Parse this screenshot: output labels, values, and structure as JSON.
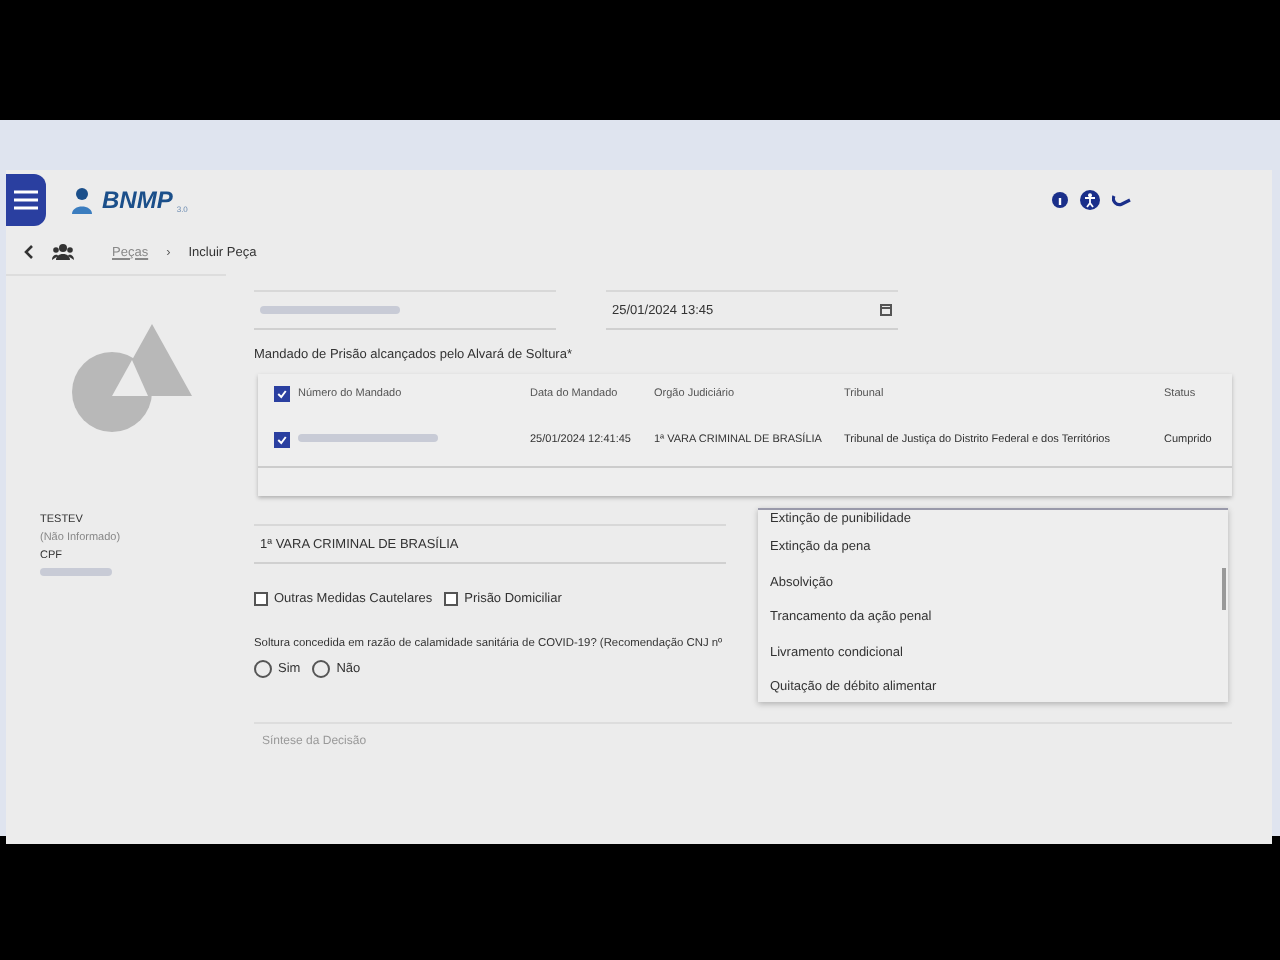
{
  "header": {
    "logo": "BNMP",
    "version": "3.0"
  },
  "breadcrumb": {
    "link": "Peças",
    "separator": "›",
    "current": "Incluir Peça"
  },
  "person": {
    "name": "TESTEV",
    "subtitle": "(Não Informado)",
    "id_label": "CPF"
  },
  "expedition_field": {
    "value": "25/01/2024 13:45"
  },
  "warrants": {
    "title": "Mandado de Prisão alcançados pelo Alvará de Soltura*",
    "all_checked": true,
    "columns": [
      "Número do Mandado",
      "Data do Mandado",
      "Orgão Judiciário",
      "Tribunal",
      "Status"
    ],
    "rows": [
      {
        "checked": true,
        "date": "25/01/2024 12:41:45",
        "organ": "1ª VARA CRIMINAL DE BRASÍLIA",
        "court": "Tribunal de Justiça do Distrito Federal e dos Territórios",
        "status": "Cumprido"
      }
    ]
  },
  "organ_field": {
    "value": "1ª VARA CRIMINAL DE BRASÍLIA"
  },
  "checkboxes": [
    {
      "label": "Outras Medidas Cautelares",
      "checked": false
    },
    {
      "label": "Prisão Domiciliar",
      "checked": false
    }
  ],
  "question": {
    "text": "Soltura concedida em razão de calamidade sanitária de COVID-19? (Recomendação CNJ nº",
    "options": [
      {
        "label": "Sim",
        "selected": false
      },
      {
        "label": "Não",
        "selected": false
      }
    ]
  },
  "dropdown": {
    "options": [
      "Extinção de punibilidade",
      "Extinção da pena",
      "Absolvição",
      "Trancamento da ação penal",
      "Livramento condicional",
      "Quitação de débito alimentar"
    ]
  },
  "decision_field": {
    "label": "Síntese da Decisão"
  }
}
